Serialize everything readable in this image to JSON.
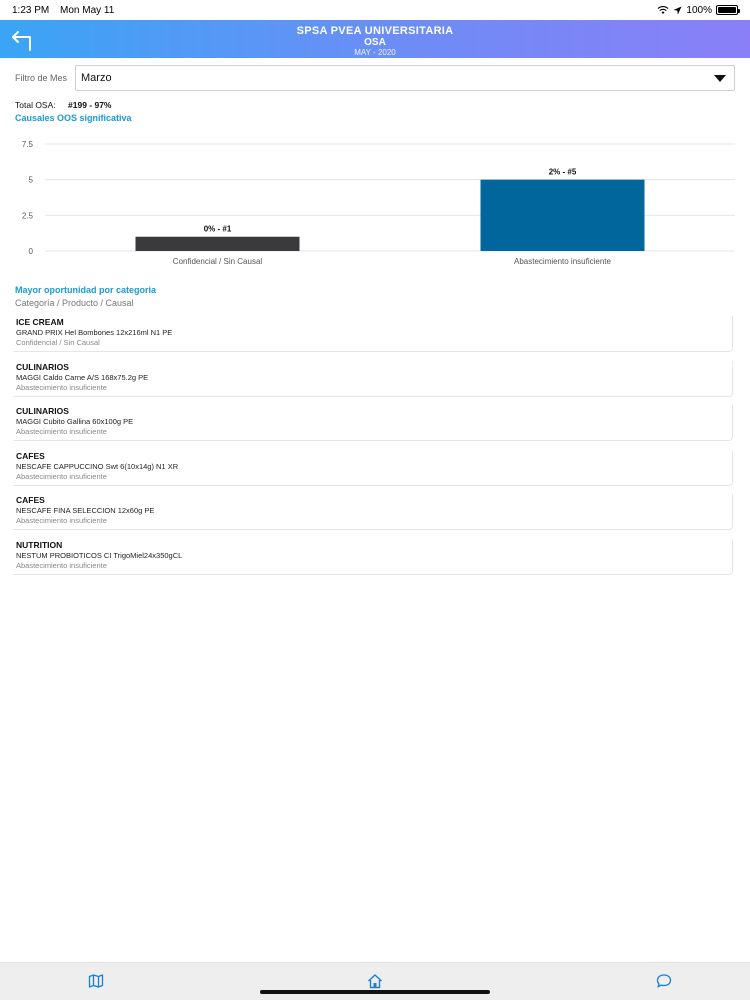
{
  "status_bar": {
    "time": "1:23 PM",
    "date": "Mon May 11",
    "battery": "100%"
  },
  "header": {
    "title": "SPSA PVEA UNIVERSITARIA",
    "subtitle": "OSA",
    "date": "MAY - 2020",
    "back_icon": "back-arrow-icon"
  },
  "filter": {
    "label": "Filtro de Mes",
    "selected": "Marzo"
  },
  "summary": {
    "label": "Total OSA:",
    "value": "#199 - 97%"
  },
  "chart_section_title": "Causales OOS  significativa",
  "chart_data": {
    "type": "bar",
    "categories": [
      "Confidencial / Sin Causal",
      "Abastecimiento insuficiente"
    ],
    "values": [
      1,
      5
    ],
    "data_labels": [
      "0% - #1",
      "2% - #5"
    ],
    "colors": [
      "#3a3a3c",
      "#00669b"
    ],
    "ylim": [
      0,
      7.5
    ],
    "yticks": [
      "0",
      "2.5",
      "5",
      "7.5"
    ],
    "grid": true
  },
  "opportunity": {
    "title": "Mayor oportunidad por categoria",
    "subheading": "Categoría / Producto / Causal",
    "items": [
      {
        "category": "ICE CREAM",
        "product": "GRAND PRIX Hel Bombones 12x216ml N1 PE",
        "cause": "Confidencial / Sin Causal"
      },
      {
        "category": "CULINARIOS",
        "product": "MAGGI Caldo Carne A/S 168x75.2g PE",
        "cause": "Abastecimiento insuficiente"
      },
      {
        "category": "CULINARIOS",
        "product": "MAGGI Cubito Gallina 60x100g PE",
        "cause": "Abastecimiento insuficiente"
      },
      {
        "category": "CAFES",
        "product": "NESCAFE CAPPUCCINO Swt 6(10x14g) N1 XR",
        "cause": "Abastecimiento insuficiente"
      },
      {
        "category": "CAFES",
        "product": "NESCAFE FINA SELECCION 12x60g PE",
        "cause": "Abastecimiento insuficiente"
      },
      {
        "category": "NUTRITION",
        "product": "NESTUM PROBIOTICOS CI TrigoMiel24x350gCL",
        "cause": "Abastecimiento insuficiente"
      }
    ]
  },
  "tab_bar": {
    "icons": [
      "map-icon",
      "home-icon",
      "chat-icon"
    ],
    "accent": "#1a7fd1"
  }
}
